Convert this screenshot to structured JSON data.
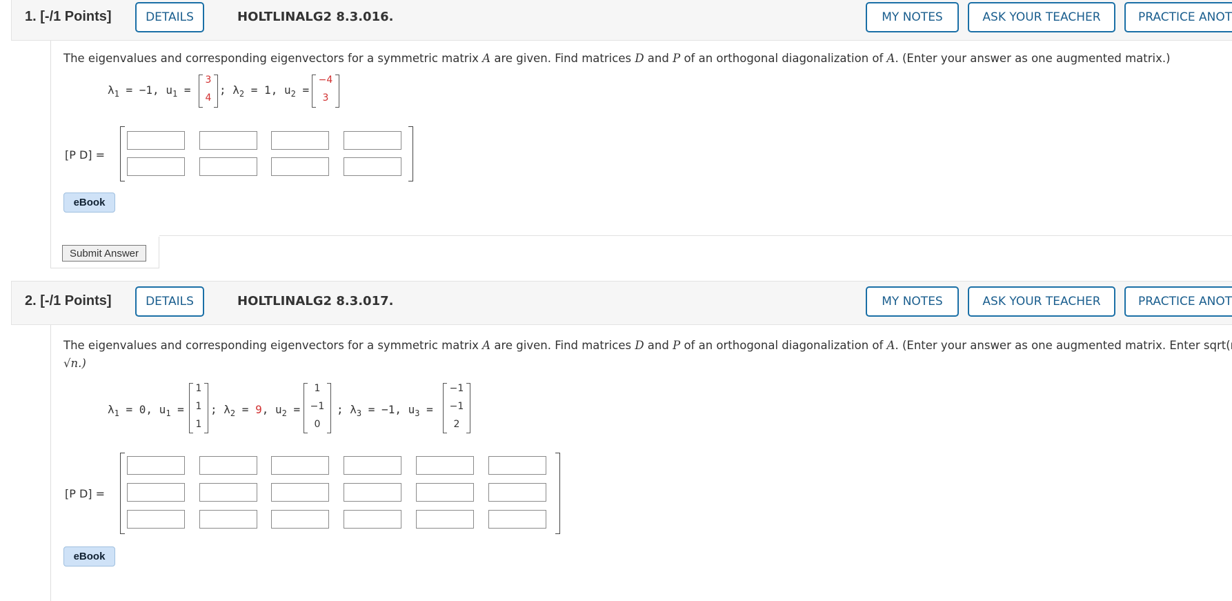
{
  "questions": [
    {
      "number": "1.",
      "points": "[-/1 Points]",
      "details_label": "DETAILS",
      "code": "HOLTLINALG2 8.3.016.",
      "my_notes": "MY NOTES",
      "ask_teacher": "ASK YOUR TEACHER",
      "practice": "PRACTICE ANOTHER",
      "prompt_parts": [
        "The eigenvalues and corresponding eigenvectors for a symmetric matrix ",
        "A",
        " are given. Find matrices ",
        "D",
        " and ",
        "P",
        " of an orthogonal diagonalization of ",
        "A",
        ". (Enter your answer as one augmented matrix.)"
      ],
      "lambda1": "λ",
      "eq1": "= −1, u",
      "eq1_end": " =",
      "vec1": [
        "3",
        "4"
      ],
      "sep": ";",
      "eq2a": "λ",
      "eq2b": " = 1, u",
      "eq2_end": " =",
      "vec2": [
        "−4",
        "3"
      ],
      "pd_label": "[P D] =",
      "ebook": "eBook",
      "submit": "Submit Answer"
    },
    {
      "number": "2.",
      "points": "[-/1 Points]",
      "details_label": "DETAILS",
      "code": "HOLTLINALG2 8.3.017.",
      "my_notes": "MY NOTES",
      "ask_teacher": "ASK YOUR TEACHER",
      "practice": "PRACTICE ANOTHER",
      "prompt_parts": [
        "The eigenvalues and corresponding eigenvectors for a symmetric matrix ",
        "A",
        " are given. Find matrices ",
        "D",
        " and ",
        "P",
        " of an orthogonal diagonalization of ",
        "A",
        ". (Enter your answer as one augmented matrix. Enter sqrt(n) for"
      ],
      "prompt_line2": "√n.)",
      "eq1": "= 0, u",
      "vec1": [
        "1",
        "1",
        "1"
      ],
      "eq2b": " = ",
      "eq2_red": "9",
      "eq2c": ", u",
      "vec2": [
        "1",
        "−1",
        "0"
      ],
      "eq3": " = −1, u",
      "vec3": [
        "−1",
        "−1",
        "2"
      ],
      "sub1": "1",
      "sub2": "2",
      "sub3": "3",
      "pd_label": "[P D] =",
      "ebook": "eBook"
    }
  ],
  "colors": {
    "accent": "#1a6fa6",
    "answer_red": "#d13030",
    "ebook_bg": "#cfe2f7"
  }
}
